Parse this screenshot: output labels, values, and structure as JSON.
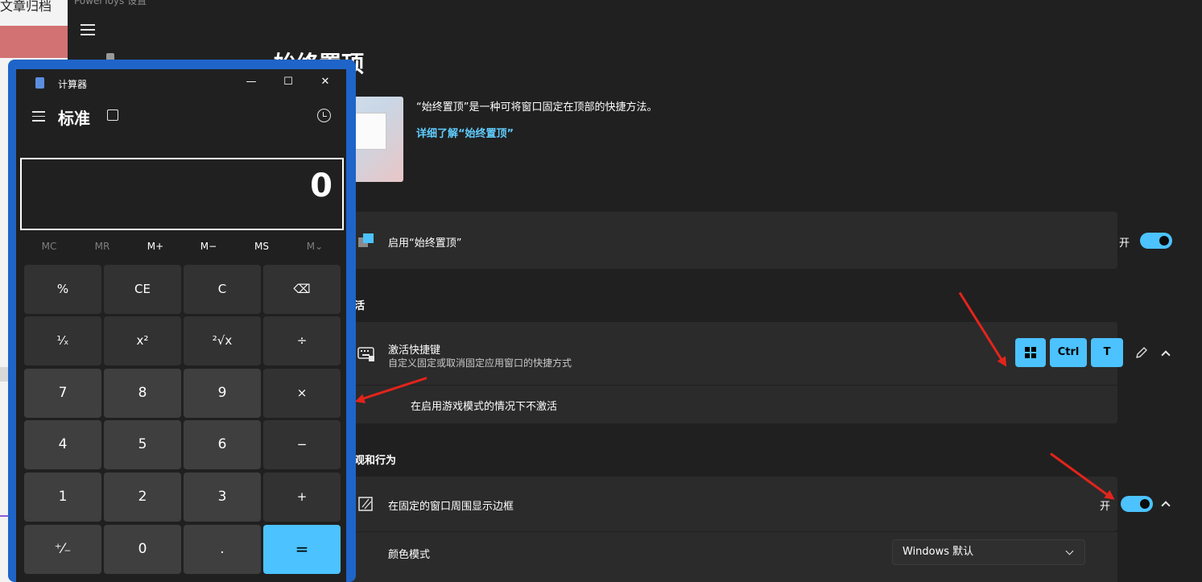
{
  "background_app": {
    "title": "文章归档"
  },
  "powertoys": {
    "window_title": "PowerToys 设置",
    "page_title": "始终置顶",
    "description": "“始终置顶”是一种可将窗口固定在顶部的快捷方法。",
    "learn_more": "详细了解“始终置顶”",
    "enable": {
      "label": "启用“始终置顶”",
      "state_label": "开",
      "on": true
    },
    "section_activation": "活",
    "activation": {
      "label": "激活快捷键",
      "sub": "自定义固定或取消固定应用窗口的快捷方式",
      "keys": [
        "Ctrl",
        "T"
      ],
      "game_mode_label": "在启用游戏模式的情况下不激活",
      "game_mode_checked": true
    },
    "section_appearance": "观和行为",
    "border": {
      "label": "在固定的窗口周围显示边框",
      "state_label": "开",
      "on": true
    },
    "color_mode": {
      "label": "颜色模式",
      "value": "Windows 默认"
    }
  },
  "calculator": {
    "title": "计算器",
    "mode": "标准",
    "display": "0",
    "memory": [
      "MC",
      "MR",
      "M+",
      "M−",
      "MS",
      "M⌄"
    ],
    "keys": [
      "%",
      "CE",
      "C",
      "⌫",
      "¹⁄ₓ",
      "x²",
      "²√x",
      "÷",
      "7",
      "8",
      "9",
      "×",
      "4",
      "5",
      "6",
      "−",
      "1",
      "2",
      "3",
      "+",
      "⁺⁄₋",
      "0",
      ".",
      "="
    ]
  },
  "colors": {
    "accent": "#4cc2ff",
    "frame": "#1f64c8",
    "annotation": "#e3241b"
  }
}
